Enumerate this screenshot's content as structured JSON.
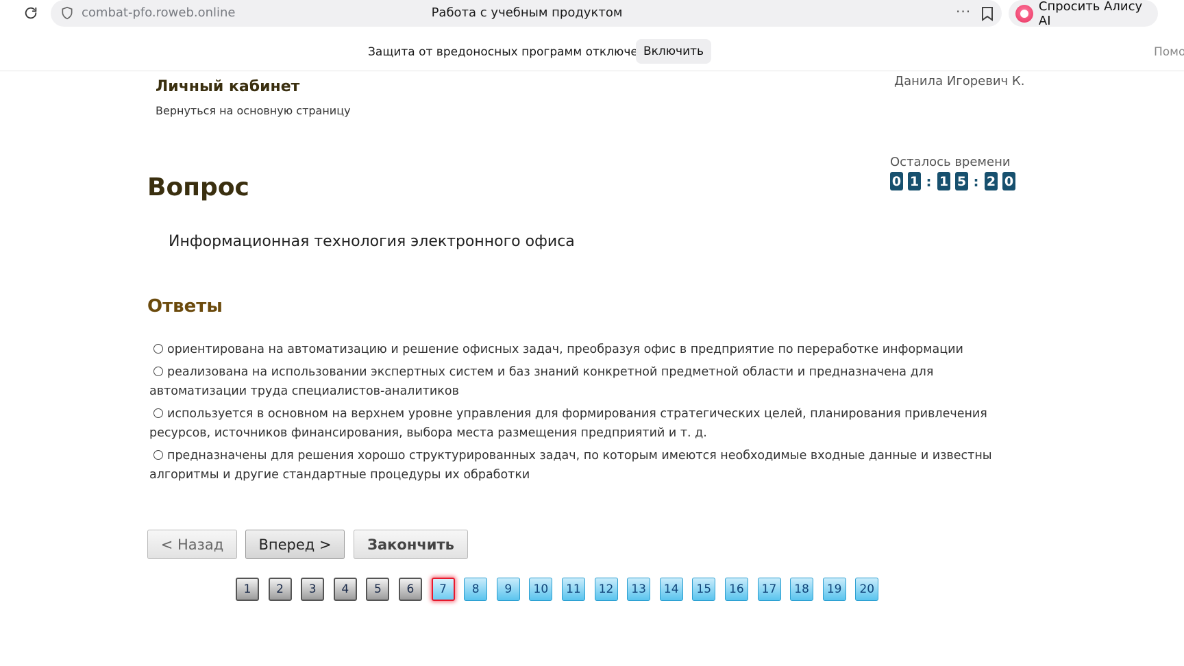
{
  "browser": {
    "url": "combat-pfo.roweb.online",
    "tab_title": "Работа с учебным продуктом",
    "alice_label": "Спросить Алису AI"
  },
  "security_bar": {
    "message": "Защита от вредоносных программ отключена",
    "enable_label": "Включить",
    "help_label": "Помо"
  },
  "header": {
    "cabinet_title": "Личный кабинет",
    "back_link": "Вернуться на основную страницу",
    "user_name": "Данила Игоревич К.",
    "time_label": "Осталось времени",
    "timer": [
      "0",
      "1",
      ":",
      "1",
      "5",
      ":",
      "2",
      "0"
    ]
  },
  "question": {
    "heading": "Вопрос",
    "text": "Информационная технология электронного офиса"
  },
  "answers": {
    "heading": "Ответы",
    "items": [
      "ориентирована на автоматизацию и решение офисных задач, преобразуя офис в предприятие по переработке информации",
      "реализована на использовании экспертных систем и баз знаний конкретной предметной области и предназначена для автоматизации труда специалистов-аналитиков",
      "используется в основном на верхнем уровне управления для формирования стратегических целей, планирования привлечения ресурсов, источников финансирования, выбора места размещения предприятий и т. д.",
      "предназначены для решения хорошо структурированных задач, по которым имеются необходимые входные данные и известны алгоритмы и другие стандартные процедуры их обработки"
    ]
  },
  "navigation": {
    "back_label": "< Назад",
    "next_label": "Вперед >",
    "finish_label": "Закончить"
  },
  "pager": {
    "pages": [
      "1",
      "2",
      "3",
      "4",
      "5",
      "6",
      "7",
      "8",
      "9",
      "10",
      "11",
      "12",
      "13",
      "14",
      "15",
      "16",
      "17",
      "18",
      "19",
      "20"
    ],
    "current": "7",
    "answered_count": 6
  },
  "colors": {
    "timer_digit": "#17506e",
    "heading_brown": "#3a2f0f",
    "answers_heading": "#6b4a0c",
    "current_page_border": "#e8192c",
    "todo_page": "#5ac4ee"
  }
}
